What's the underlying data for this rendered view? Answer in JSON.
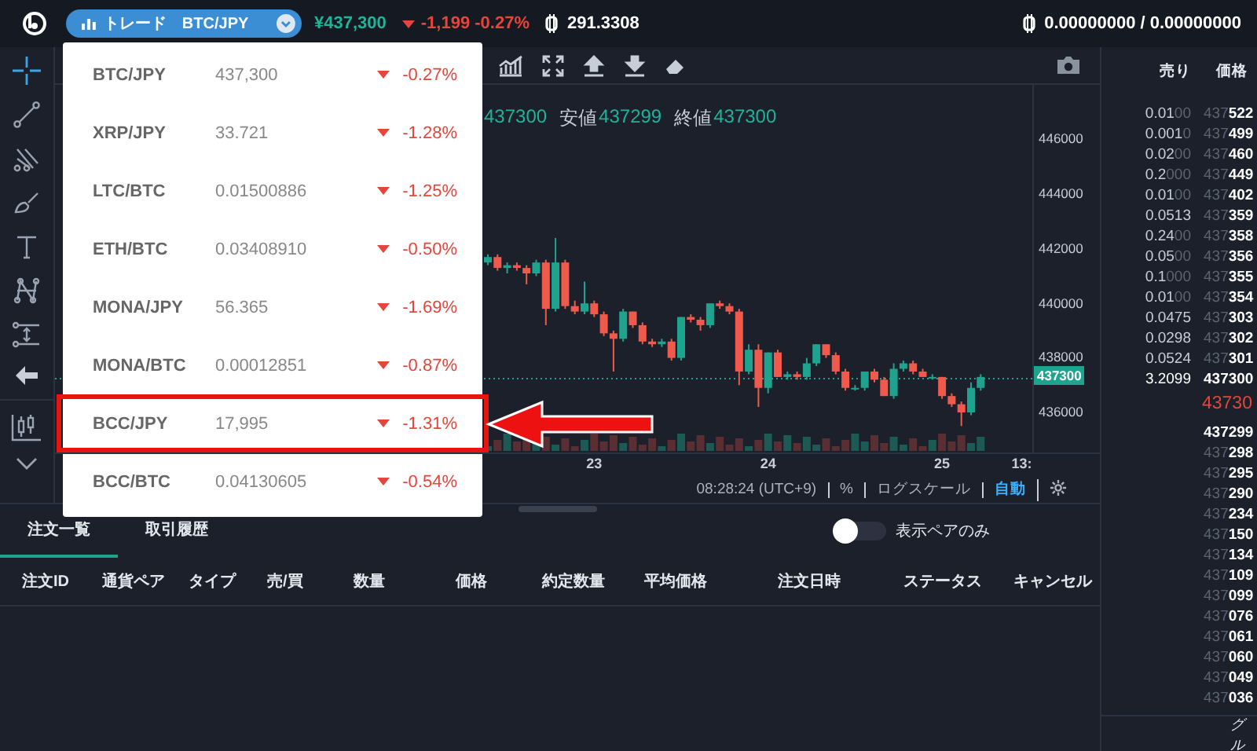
{
  "topbar": {
    "mode_label": "トレード",
    "pair": "BTC/JPY",
    "price": "¥437,300",
    "falling": true,
    "change": "-1,199 -0.27%",
    "btc_balance": "291.3308",
    "wallet": "0.00000000 / 0.00000000"
  },
  "pair_menu": [
    {
      "pair": "BTC/JPY",
      "price": "437,300",
      "falling": true,
      "change": "-0.27%",
      "annotated": false
    },
    {
      "pair": "XRP/JPY",
      "price": "33.721",
      "falling": true,
      "change": "-1.28%",
      "annotated": false
    },
    {
      "pair": "LTC/BTC",
      "price": "0.01500886",
      "falling": true,
      "change": "-1.25%",
      "annotated": false
    },
    {
      "pair": "ETH/BTC",
      "price": "0.03408910",
      "falling": true,
      "change": "-0.50%",
      "annotated": false
    },
    {
      "pair": "MONA/JPY",
      "price": "56.365",
      "falling": true,
      "change": "-1.69%",
      "annotated": false
    },
    {
      "pair": "MONA/BTC",
      "price": "0.00012851",
      "falling": true,
      "change": "-0.87%",
      "annotated": false
    },
    {
      "pair": "BCC/JPY",
      "price": "17,995",
      "falling": true,
      "change": "-1.31%",
      "annotated": true
    },
    {
      "pair": "BCC/BTC",
      "price": "0.04130605",
      "falling": true,
      "change": "-0.54%",
      "annotated": false
    }
  ],
  "chart": {
    "ohlc": [
      {
        "value": "437300"
      },
      {
        "label": "安値",
        "value": "437299"
      },
      {
        "label": "終値",
        "value": "437300"
      }
    ],
    "chart_data": {
      "type": "candlestick",
      "ylim": [
        434530,
        448017
      ],
      "yticks": [
        446000,
        444000,
        442000,
        440000,
        438000,
        436000
      ],
      "ohlc": [
        [
          441500,
          441800,
          441400,
          441700
        ],
        [
          441700,
          441800,
          441200,
          441300
        ],
        [
          441300,
          441500,
          441100,
          441400
        ],
        [
          441400,
          441500,
          441200,
          441300
        ],
        [
          441300,
          441400,
          440700,
          441100
        ],
        [
          441100,
          441600,
          441000,
          441500
        ],
        [
          441500,
          441600,
          439200,
          439800
        ],
        [
          439800,
          442400,
          439700,
          441500
        ],
        [
          441500,
          441600,
          439800,
          439900
        ],
        [
          439900,
          440100,
          439600,
          439700
        ],
        [
          439700,
          440800,
          439600,
          440000
        ],
        [
          440000,
          440100,
          439500,
          439600
        ],
        [
          439600,
          439700,
          438800,
          438900
        ],
        [
          438900,
          439000,
          437500,
          438700
        ],
        [
          438700,
          439800,
          438600,
          439700
        ],
        [
          439700,
          439700,
          439100,
          439200
        ],
        [
          439200,
          439300,
          438500,
          438600
        ],
        [
          438600,
          438700,
          438400,
          438500
        ],
        [
          438500,
          438700,
          438400,
          438600
        ],
        [
          438600,
          438700,
          437900,
          438000
        ],
        [
          438000,
          439500,
          437900,
          439500
        ],
        [
          439500,
          439600,
          439300,
          439400
        ],
        [
          439400,
          439500,
          439000,
          439200
        ],
        [
          439200,
          440000,
          439100,
          440000
        ],
        [
          440000,
          440100,
          439800,
          439900
        ],
        [
          439900,
          440000,
          439600,
          439700
        ],
        [
          439700,
          439800,
          437000,
          437500
        ],
        [
          437500,
          438500,
          437400,
          438300
        ],
        [
          438300,
          438500,
          436200,
          436900
        ],
        [
          436900,
          438200,
          436700,
          438200
        ],
        [
          438200,
          438300,
          437300,
          437300
        ],
        [
          437300,
          437500,
          437200,
          437400
        ],
        [
          437400,
          437500,
          437200,
          437300
        ],
        [
          437300,
          438000,
          437200,
          437800
        ],
        [
          437800,
          438500,
          437700,
          438500
        ],
        [
          438500,
          438500,
          438000,
          438100
        ],
        [
          438100,
          438200,
          437400,
          437500
        ],
        [
          437500,
          437600,
          436800,
          436900
        ],
        [
          436900,
          437000,
          436800,
          436900
        ],
        [
          436900,
          437500,
          436800,
          437500
        ],
        [
          437500,
          437600,
          437100,
          437200
        ],
        [
          437200,
          437300,
          436600,
          436600
        ],
        [
          436600,
          437800,
          436500,
          437600
        ],
        [
          437600,
          437900,
          437500,
          437800
        ],
        [
          437800,
          437900,
          437400,
          437500
        ],
        [
          437500,
          437600,
          437300,
          437300
        ],
        [
          437300,
          437400,
          437200,
          437300
        ],
        [
          437300,
          437300,
          436500,
          436600
        ],
        [
          436600,
          436700,
          436200,
          436300
        ],
        [
          436300,
          436400,
          435500,
          436000
        ],
        [
          436000,
          437100,
          435900,
          436900
        ],
        [
          436900,
          437400,
          436800,
          437300
        ]
      ]
    },
    "x_axis_labels": [
      "23",
      "24",
      "25",
      "13:"
    ],
    "last_price": "437300",
    "footer": {
      "time": "08:28:24 (UTC+9)",
      "items": [
        {
          "label": "%",
          "selected": false
        },
        {
          "label": "ログスケール",
          "selected": false
        },
        {
          "label": "自動",
          "selected": true
        }
      ]
    }
  },
  "orders": {
    "tabs": [
      {
        "label": "注文一覧",
        "selected": true
      },
      {
        "label": "取引履歴",
        "selected": false
      }
    ],
    "toggle": {
      "label": "表示ペアのみ",
      "on": false
    },
    "columns": [
      "注文ID",
      "通貨ペア",
      "タイプ",
      "売/買",
      "数量",
      "価格",
      "約定数量",
      "平均価格",
      "注文日時",
      "ステータス",
      "キャンセル"
    ]
  },
  "order_book": {
    "columns": [
      "売り",
      "価格"
    ],
    "asks": [
      {
        "amount": "0.0100",
        "price": "437522",
        "best": false
      },
      {
        "amount": "0.0010",
        "price": "437499",
        "best": false
      },
      {
        "amount": "0.0200",
        "price": "437460",
        "best": false
      },
      {
        "amount": "0.2000",
        "price": "437449",
        "best": false
      },
      {
        "amount": "0.0100",
        "price": "437402",
        "best": false
      },
      {
        "amount": "0.0513",
        "price": "437359",
        "best": false
      },
      {
        "amount": "0.2400",
        "price": "437358",
        "best": false
      },
      {
        "amount": "0.0500",
        "price": "437356",
        "best": false
      },
      {
        "amount": "0.1000",
        "price": "437355",
        "best": false
      },
      {
        "amount": "0.0100",
        "price": "437354",
        "best": false
      },
      {
        "amount": "0.0475",
        "price": "437303",
        "best": false
      },
      {
        "amount": "0.0298",
        "price": "437302",
        "best": false
      },
      {
        "amount": "0.0524",
        "price": "437301",
        "best": false
      },
      {
        "amount": "3.2099",
        "price": "437300",
        "best": true
      }
    ],
    "mid_price": "43730",
    "bids": [
      {
        "price": "437299",
        "best": true
      },
      {
        "price": "437298",
        "best": false
      },
      {
        "price": "437295",
        "best": false
      },
      {
        "price": "437290",
        "best": false
      },
      {
        "price": "437234",
        "best": false
      },
      {
        "price": "437150",
        "best": false
      },
      {
        "price": "437134",
        "best": false
      },
      {
        "price": "437109",
        "best": false
      },
      {
        "price": "437099",
        "best": false
      },
      {
        "price": "437076",
        "best": false
      },
      {
        "price": "437061",
        "best": false
      },
      {
        "price": "437060",
        "best": false
      },
      {
        "price": "437049",
        "best": false
      },
      {
        "price": "437036",
        "best": false
      }
    ],
    "footer": "グル"
  }
}
